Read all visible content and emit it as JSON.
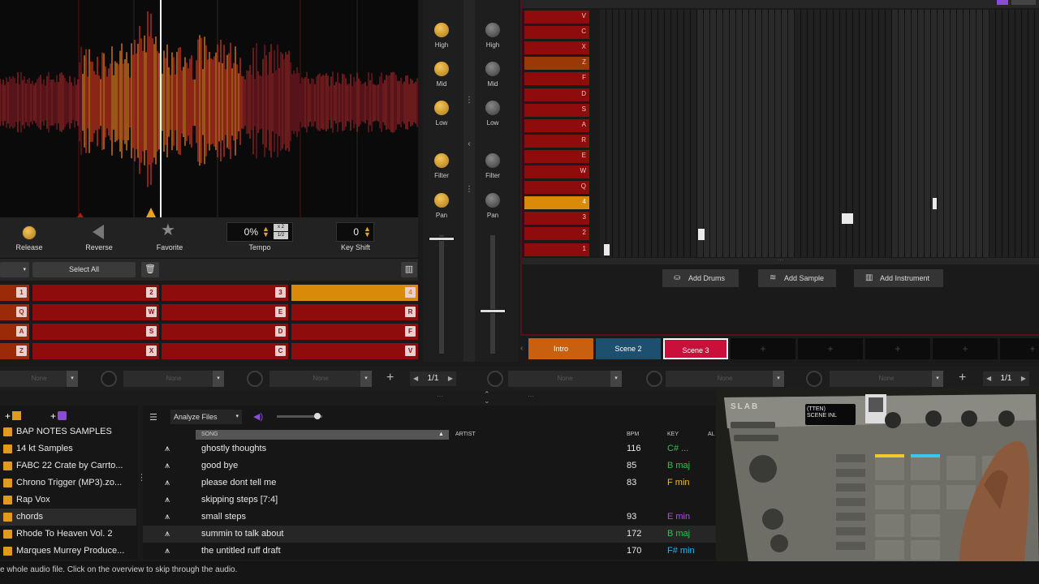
{
  "deck": {
    "release_label": "Release",
    "reverse_label": "Reverse",
    "favorite_label": "Favorite",
    "tempo_label": "Tempo",
    "tempo_value": "0%",
    "tempo_x2": "x 2",
    "tempo_half": "1/2",
    "keyshift_label": "Key Shift",
    "keyshift_value": "0",
    "select_all_label": "Select All"
  },
  "pads": [
    {
      "num": "1",
      "key": "1"
    },
    {
      "num": "2",
      "key": "2"
    },
    {
      "num": "3",
      "key": "3"
    },
    {
      "num": "4",
      "key": "4"
    },
    {
      "key": "Q"
    },
    {
      "key": "W"
    },
    {
      "key": "E"
    },
    {
      "key": "R"
    },
    {
      "key": "A"
    },
    {
      "key": "S"
    },
    {
      "key": "D"
    },
    {
      "key": "F"
    },
    {
      "key": "Z"
    },
    {
      "key": "X"
    },
    {
      "key": "C"
    },
    {
      "key": "V"
    }
  ],
  "fx": {
    "none_label": "None",
    "page_left": "1/1",
    "page_right": "1/1"
  },
  "mixer": {
    "high": "High",
    "mid": "Mid",
    "low": "Low",
    "filter": "Filter",
    "pan": "Pan"
  },
  "sequencer": {
    "rows": [
      "V",
      "C",
      "X",
      "Z",
      "F",
      "D",
      "S",
      "A",
      "R",
      "E",
      "W",
      "Q",
      "4",
      "3",
      "2",
      "1"
    ],
    "add_drums": "Add Drums",
    "add_sample": "Add Sample",
    "add_instrument": "Add Instrument"
  },
  "scenes": [
    {
      "name": "Intro",
      "color": "#c8600f"
    },
    {
      "name": "Scene 2",
      "color": "#1d4f6e"
    },
    {
      "name": "Scene 3",
      "color": "#c8103a"
    }
  ],
  "browser": {
    "analyze_label": "Analyze Files",
    "columns": {
      "song": "SONG",
      "artist": "ARTIST",
      "bpm": "BPM",
      "key": "KEY",
      "al": "AL"
    },
    "sources": [
      "BAP NOTES SAMPLES",
      "14 kt Samples",
      "FABC 22 Crate by Carrto...",
      "Chrono Trigger (MP3).zo...",
      "Rap Vox",
      "chords",
      "Rhode To Heaven Vol. 2",
      "Marques Murrey Produce..."
    ],
    "songs": [
      {
        "song": "ghostly thoughts",
        "bpm": "116",
        "key": "C# ...",
        "key_color": "#2fc24a"
      },
      {
        "song": "good bye",
        "bpm": "85",
        "key": "B maj",
        "key_color": "#2fc24a"
      },
      {
        "song": "please dont tell me",
        "bpm": "83",
        "key": "F min",
        "key_color": "#f0c020"
      },
      {
        "song": "skipping steps [7:4]",
        "bpm": "",
        "key": "",
        "key_color": "#ffffff"
      },
      {
        "song": "small steps",
        "bpm": "93",
        "key": "E min",
        "key_color": "#b44ce0"
      },
      {
        "song": "summin to talk about",
        "bpm": "172",
        "key": "B maj",
        "key_color": "#2fc24a"
      },
      {
        "song": "the untitled ruff draft",
        "bpm": "170",
        "key": "F# min",
        "key_color": "#27b5e8"
      }
    ]
  },
  "status_text": "e whole audio file. Click on the overview to skip through the audio.",
  "webcam": {
    "device_brand": "SLAB",
    "screen_line1": "(TTEN)",
    "screen_line2": "SCENE INL"
  }
}
